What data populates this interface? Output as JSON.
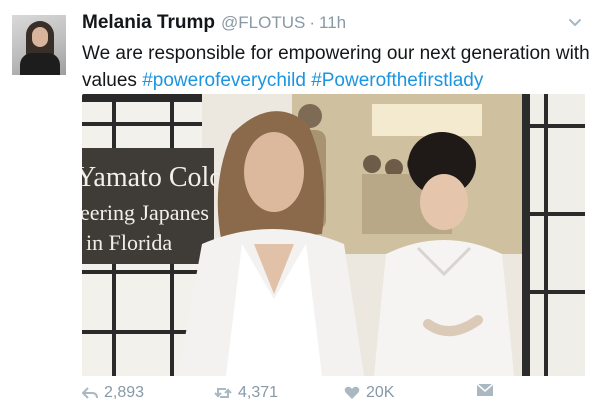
{
  "tweet": {
    "display_name": "Melania Trump",
    "handle": "@FLOTUS",
    "separator": "·",
    "time": "11h",
    "text_line1": "We are responsible for empowering our next generation with",
    "text_line2_plain": "values",
    "hashtag1": "#powerofeverychild",
    "hashtag2": "#Powerofthefirstlady"
  },
  "media": {
    "sign_line1": "Yamato Colo",
    "sign_line2": "eering Japanes",
    "sign_line3": "in Florida"
  },
  "actions": {
    "reply_count": "2,893",
    "retweet_count": "4,371",
    "like_count": "20K"
  },
  "icons": {
    "caret": "chevron-down-icon",
    "reply": "reply-icon",
    "retweet": "retweet-icon",
    "like": "heart-icon",
    "dm": "envelope-icon"
  },
  "colors": {
    "hashtag": "#1b95e0",
    "muted": "#8899a6",
    "text": "#14171a"
  }
}
